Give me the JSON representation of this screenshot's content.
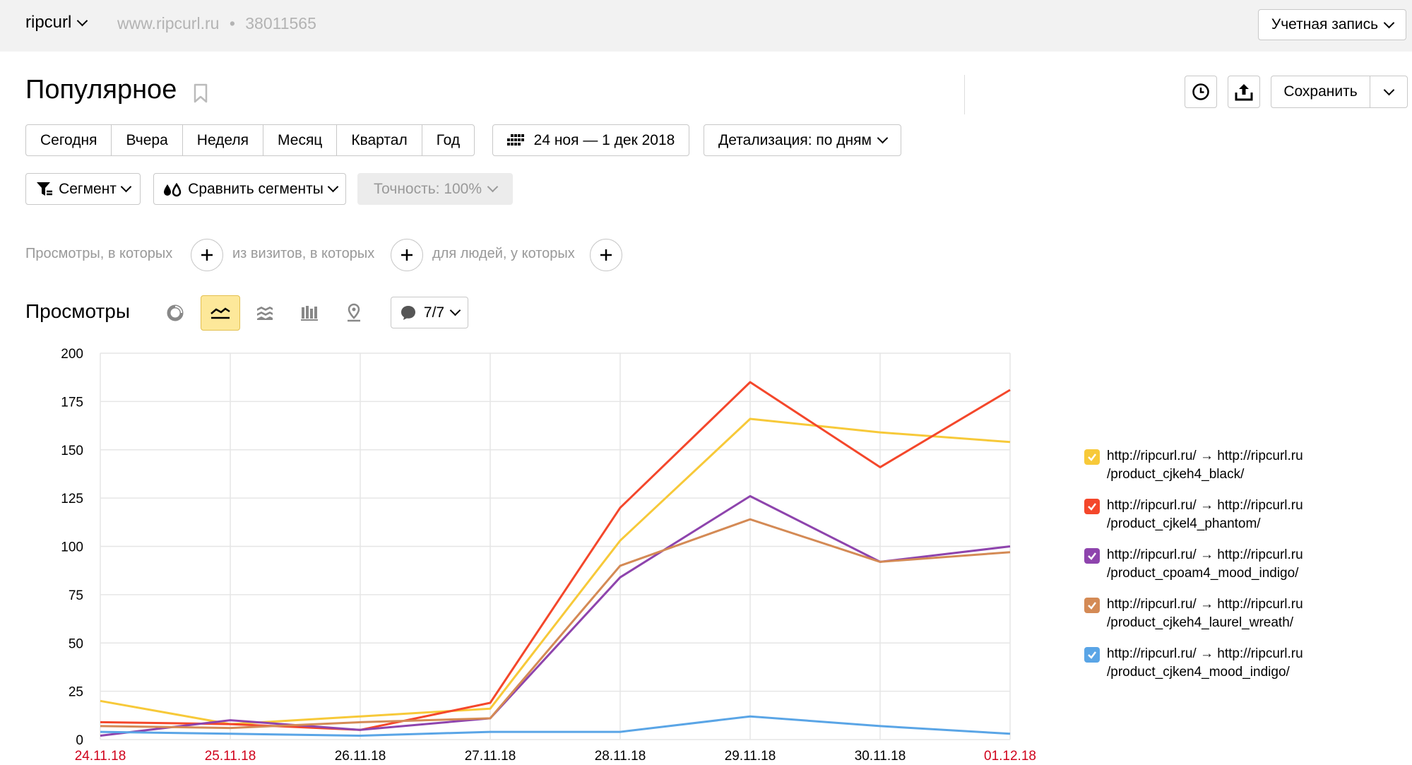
{
  "topbar": {
    "site_name": "ripcurl",
    "site_url": "www.ripcurl.ru",
    "counter_sep": "•",
    "counter_id": "38011565",
    "account_label": "Учетная запись"
  },
  "header": {
    "title": "Популярное",
    "save_label": "Сохранить"
  },
  "periods": [
    "Сегодня",
    "Вчера",
    "Неделя",
    "Месяц",
    "Квартал",
    "Год"
  ],
  "date_range": "24 ноя — 1 дек 2018",
  "detail_label": "Детализация: по дням",
  "segment_label": "Сегмент",
  "compare_label": "Сравнить сегменты",
  "precision_label": "Точность: 100%",
  "filters": {
    "views": "Просмотры, в которых",
    "visits": "из визитов, в которых",
    "people": "для людей, у которых"
  },
  "metric_title": "Просмотры",
  "series_count": "7/7",
  "icons": {
    "bookmark": "bookmark-icon",
    "history": "clock-icon",
    "export": "upload-icon",
    "calendar": "calendar-icon",
    "segment": "filter-icon",
    "compare": "drops-icon",
    "pie": "pie-chart-icon",
    "line": "line-chart-icon",
    "area": "area-chart-icon",
    "bars": "bar-chart-icon",
    "map": "map-pin-icon",
    "annotation": "comment-icon"
  },
  "chart_data": {
    "type": "line",
    "x": [
      "24.11.18",
      "25.11.18",
      "26.11.18",
      "27.11.18",
      "28.11.18",
      "29.11.18",
      "30.11.18",
      "01.12.18"
    ],
    "weekend_x": [
      "24.11.18",
      "25.11.18",
      "01.12.18"
    ],
    "ylim": [
      0,
      200
    ],
    "yticks": [
      0,
      25,
      50,
      75,
      100,
      125,
      150,
      175,
      200
    ],
    "grid": true,
    "legend": "right",
    "series": [
      {
        "name": "http://ripcurl.ru/ → http://ripcurl.ru\n/product_cjkeh4_black/",
        "color": "#f7c939",
        "values": [
          20,
          8,
          12,
          16,
          103,
          166,
          159,
          154
        ]
      },
      {
        "name": "http://ripcurl.ru/ → http://ripcurl.ru\n/product_cjkel4_phantom/",
        "color": "#f4472b",
        "values": [
          9,
          8,
          5,
          19,
          120,
          185,
          141,
          181
        ]
      },
      {
        "name": "http://ripcurl.ru/ → http://ripcurl.ru\n/product_cpoam4_mood_indigo/",
        "color": "#8e44ad",
        "values": [
          2,
          10,
          5,
          11,
          84,
          126,
          92,
          100
        ]
      },
      {
        "name": "http://ripcurl.ru/ → http://ripcurl.ru\n/product_cjkeh4_laurel_wreath/",
        "color": "#d48a55",
        "values": [
          7,
          6,
          9,
          11,
          90,
          114,
          92,
          97
        ]
      },
      {
        "name": "http://ripcurl.ru/ → http://ripcurl.ru\n/product_cjken4_mood_indigo/",
        "color": "#5aa5e6",
        "values": [
          4,
          3,
          2,
          4,
          4,
          12,
          7,
          3
        ]
      }
    ]
  }
}
